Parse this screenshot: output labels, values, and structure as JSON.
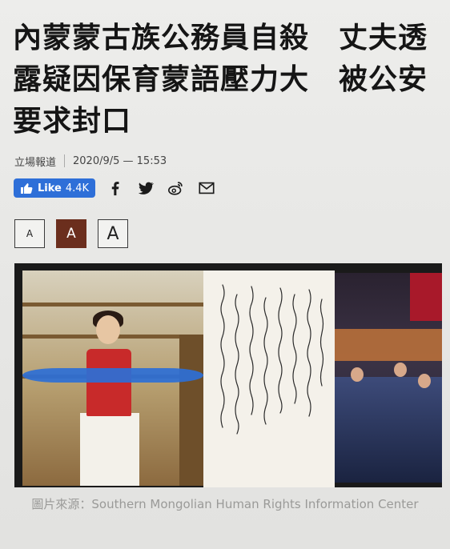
{
  "article": {
    "headline": "內蒙蒙古族公務員自殺　丈夫透露疑因保育蒙語壓力大　被公安要求封口",
    "source": "立場報道",
    "datetime": "2020/9/5 — 15:53"
  },
  "social": {
    "like_label": "Like",
    "like_count": "4.4K",
    "share_icons": [
      "facebook-icon",
      "twitter-icon",
      "weibo-icon",
      "mail-icon"
    ],
    "like_color": "#2e6fd8"
  },
  "font_size_controls": {
    "small": "A",
    "medium": "A",
    "large": "A",
    "active_color": "#6b2e1d"
  },
  "figure": {
    "caption": "圖片來源：Southern Mongolian Human Rights Information Center"
  }
}
